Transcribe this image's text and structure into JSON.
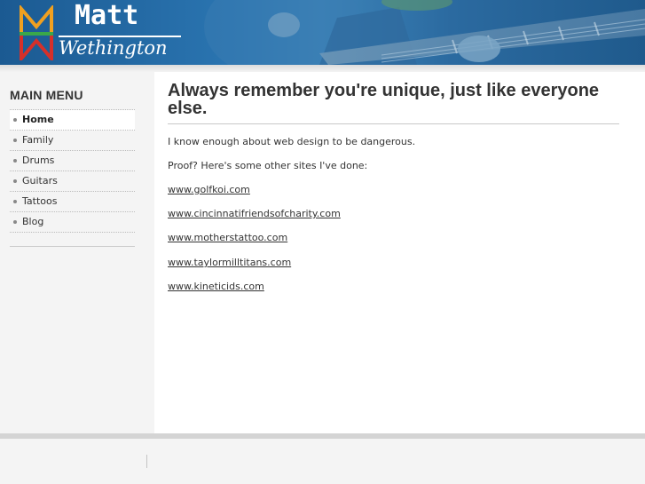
{
  "header": {
    "logo_name": "Matt",
    "logo_sub": "Wethington"
  },
  "sidebar": {
    "title": "MAIN MENU",
    "items": [
      {
        "label": "Home",
        "active": true
      },
      {
        "label": "Family"
      },
      {
        "label": "Drums"
      },
      {
        "label": "Guitars"
      },
      {
        "label": "Tattoos"
      },
      {
        "label": "Blog"
      }
    ]
  },
  "main": {
    "title": "Always remember you're unique, just like everyone else.",
    "intro": "I know enough about web design to be dangerous.",
    "proof": "Proof? Here's some other sites I've done:",
    "links": [
      "www.golfkoi.com",
      "www.cincinnatifriendsofcharity.com",
      "www.motherstattoo.com",
      "www.taylormilltitans.com",
      "www.kineticids.com"
    ]
  },
  "colors": {
    "header_blue": "#2a74b0",
    "logo_red": "#d6302a",
    "logo_green": "#3aa84a",
    "logo_orange": "#f0a020"
  }
}
